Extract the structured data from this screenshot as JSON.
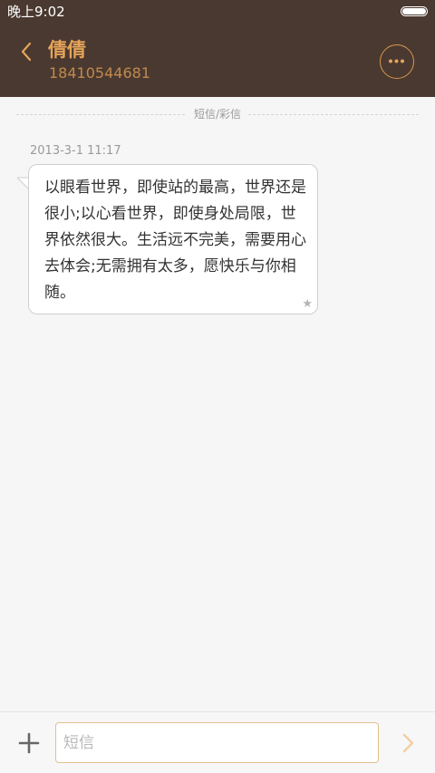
{
  "status_bar": {
    "time": "晚上9:02"
  },
  "header": {
    "contact_name": "倩倩",
    "contact_number": "18410544681"
  },
  "divider": {
    "label": "短信/彩信"
  },
  "messages": [
    {
      "timestamp": "2013-3-1 11:17",
      "text": "以眼看世界，即使站的最高，世界还是很小;以心看世界，即使身处局限，世界依然很大。生活远不完美，需要用心去体会;无需拥有太多，愿快乐与你相随。",
      "star": "★"
    }
  ],
  "composer": {
    "placeholder": "短信"
  },
  "colors": {
    "header_bg": "#4a3930",
    "accent": "#e6a45a",
    "background": "#f6f6f6"
  },
  "icons": {
    "back": "chevron-left-icon",
    "more": "more-dots-icon",
    "add": "plus-icon",
    "send": "send-arrow-icon",
    "battery": "battery-icon",
    "star": "star-icon"
  }
}
